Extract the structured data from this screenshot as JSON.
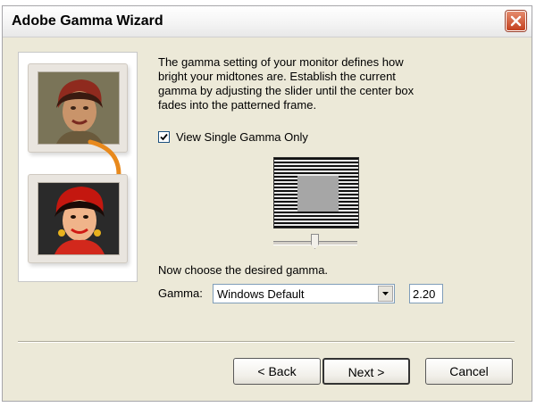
{
  "window": {
    "title": "Adobe Gamma Wizard"
  },
  "description": "The gamma setting of your monitor defines how bright your midtones are. Establish the current gamma by adjusting the slider until the center box fades into the patterned frame.",
  "checkbox": {
    "label": "View Single Gamma Only",
    "checked": true
  },
  "prompt": "Now choose the desired gamma.",
  "gamma": {
    "label": "Gamma:",
    "selected": "Windows Default",
    "value": "2.20"
  },
  "buttons": {
    "back": "< Back",
    "next": "Next >",
    "cancel": "Cancel"
  },
  "colors": {
    "dialog_bg": "#ece9d8",
    "close_button": "#c4411f",
    "arrow_orange": "#e8891c"
  },
  "icons": [
    "close-icon",
    "check-icon",
    "dropdown-arrow-icon"
  ]
}
